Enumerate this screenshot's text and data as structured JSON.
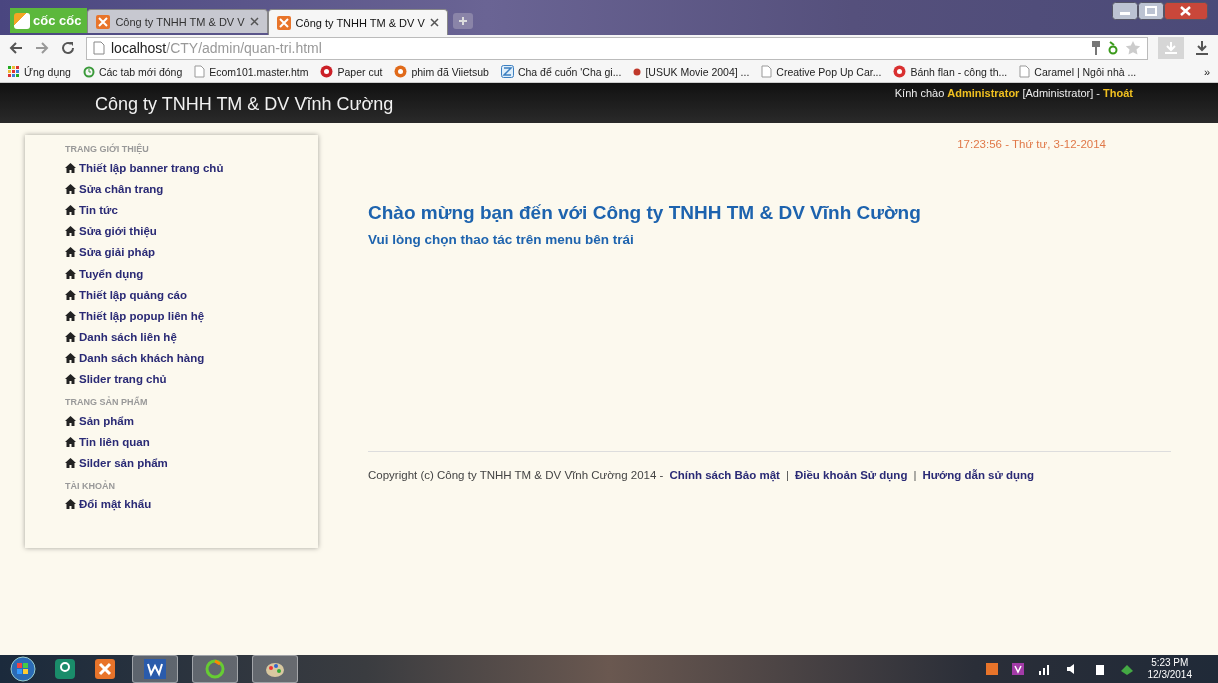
{
  "browser": {
    "logo": "cốc cốc",
    "tabs": [
      {
        "title": "Công ty TNHH TM & DV V",
        "selected": false
      },
      {
        "title": "Công ty TNHH TM & DV V",
        "selected": true
      }
    ],
    "address": {
      "host": "localhost",
      "path": "/CTY/admin/quan-tri.html"
    },
    "bookmarks": [
      {
        "label": "Ứng dụng",
        "kind": "apps"
      },
      {
        "label": "Các tab mới đóng",
        "kind": "history"
      },
      {
        "label": "Ecom101.master.htm",
        "kind": "page"
      },
      {
        "label": "Paper cut",
        "kind": "pin"
      },
      {
        "label": "phim đã Viietsub",
        "kind": "k"
      },
      {
        "label": "Cha để cuốn 'Cha gi...",
        "kind": "z"
      },
      {
        "label": "[USUK Movie 2004] ...",
        "kind": "dot"
      },
      {
        "label": "Creative Pop Up Car...",
        "kind": "page"
      },
      {
        "label": "Bánh flan - công th...",
        "kind": "a"
      },
      {
        "label": "Caramel | Ngôi nhà ...",
        "kind": "page"
      }
    ],
    "more": "»"
  },
  "header": {
    "title": "Công ty TNHH TM & DV Vĩnh Cường",
    "greeting": "Kính chào",
    "user": "Administrator",
    "role": "[Administrator] -",
    "logout": "Thoát"
  },
  "sidebar": [
    {
      "heading": "TRANG GIỚI THIỆU",
      "items": [
        "Thiết lập banner trang chủ",
        "Sửa chân trang",
        "Tin tức",
        "Sửa giới thiệu",
        "Sửa giải pháp",
        "Tuyển dụng",
        "Thiết lập quảng cáo",
        "Thiết lập popup liên hệ",
        "Danh sách liên hệ",
        "Danh sách khách hàng",
        "Slider trang chủ"
      ]
    },
    {
      "heading": "TRANG SẢN PHẨM",
      "items": [
        "Sản phẩm",
        "Tin liên quan",
        "Silder sản phẩm"
      ]
    },
    {
      "heading": "TÀI KHOẢN",
      "items": [
        "Đổi mật khẩu"
      ]
    }
  ],
  "datetime": "17:23:56 - Thứ tư, 3-12-2014",
  "welcome": {
    "title": "Chào mừng bạn đến với Công ty TNHH TM & DV Vĩnh Cường",
    "subtitle": "Vui lòng chọn thao tác trên menu bên trái"
  },
  "footer": {
    "copyright": "Copyright (c) Công ty TNHH TM & DV Vĩnh Cường 2014  -",
    "links": [
      "Chính sách Bảo mật",
      "Điều khoản Sử dụng",
      "Hướng dẫn sử dụng"
    ],
    "separator": "|"
  },
  "taskbar": {
    "time": "5:23 PM",
    "date": "12/3/2014"
  }
}
